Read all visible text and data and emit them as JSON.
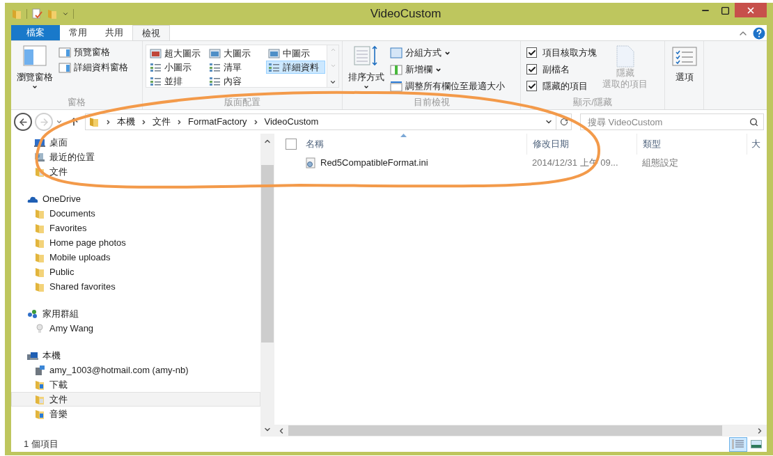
{
  "window": {
    "title": "VideoCustom"
  },
  "ribbon_tabs": [
    {
      "label": "檔案",
      "kind": "file",
      "selected": false
    },
    {
      "label": "常用",
      "kind": "tab",
      "selected": false
    },
    {
      "label": "共用",
      "kind": "tab",
      "selected": false
    },
    {
      "label": "檢視",
      "kind": "tab",
      "selected": true
    }
  ],
  "ribbon": {
    "panes": {
      "title": "窗格",
      "large": "瀏覽窗格",
      "small": [
        "預覽窗格",
        "詳細資料窗格"
      ]
    },
    "layout": {
      "title": "版面配置",
      "options": [
        {
          "label": "超大圖示",
          "selected": false
        },
        {
          "label": "大圖示",
          "selected": false
        },
        {
          "label": "中圖示",
          "selected": false
        },
        {
          "label": "小圖示",
          "selected": false
        },
        {
          "label": "清單",
          "selected": false
        },
        {
          "label": "詳細資料",
          "selected": true
        },
        {
          "label": "並排",
          "selected": false
        },
        {
          "label": "內容",
          "selected": false
        }
      ]
    },
    "current_view": {
      "title": "目前檢視",
      "large": "排序方式",
      "small": [
        {
          "label": "分組方式",
          "dropdown": true
        },
        {
          "label": "新增欄",
          "dropdown": true
        },
        {
          "label": "調整所有欄位至最適大小",
          "dropdown": false
        }
      ]
    },
    "show_hide": {
      "title": "顯示/隱藏",
      "checkboxes": [
        {
          "label": "項目核取方塊",
          "checked": true
        },
        {
          "label": "副檔名",
          "checked": true
        },
        {
          "label": "隱藏的項目",
          "checked": true
        }
      ],
      "hide_selected": {
        "lines": [
          "隱藏",
          "選取的項目"
        ],
        "disabled": true
      }
    },
    "options": {
      "label": "選項"
    }
  },
  "address": {
    "back_disabled": false,
    "forward_disabled": true,
    "path": [
      "本機",
      "文件",
      "FormatFactory",
      "VideoCustom"
    ],
    "search_placeholder": "搜尋 VideoCustom"
  },
  "nav_tree": [
    {
      "children": [
        {
          "label": "桌面",
          "kind": "desktop",
          "selected": false
        },
        {
          "label": "最近的位置",
          "kind": "recent",
          "selected": false
        },
        {
          "label": "文件",
          "kind": "docs",
          "selected": false
        }
      ]
    },
    {
      "label": "OneDrive",
      "kind": "cloud",
      "selected": false,
      "children": [
        {
          "label": "Documents",
          "kind": "folder",
          "selected": false
        },
        {
          "label": "Favorites",
          "kind": "folder",
          "selected": false
        },
        {
          "label": "Home page photos",
          "kind": "folder",
          "selected": false
        },
        {
          "label": "Mobile uploads",
          "kind": "folder",
          "selected": false
        },
        {
          "label": "Public",
          "kind": "folder",
          "selected": false
        },
        {
          "label": "Shared favorites",
          "kind": "folder",
          "selected": false
        }
      ]
    },
    {
      "label": "家用群組",
      "kind": "homegroup",
      "selected": false,
      "children": [
        {
          "label": "Amy Wang",
          "kind": "user",
          "selected": false
        }
      ]
    },
    {
      "label": "本機",
      "kind": "computer",
      "selected": false,
      "children": [
        {
          "label": "amy_1003@hotmail.com (amy-nb)",
          "kind": "drive",
          "selected": false
        },
        {
          "label": "下載",
          "kind": "download",
          "selected": false
        },
        {
          "label": "文件",
          "kind": "docs",
          "selected": true
        },
        {
          "label": "音樂",
          "kind": "music",
          "selected": false
        }
      ]
    }
  ],
  "file_list": {
    "select_all_checked": false,
    "columns": [
      "名稱",
      "修改日期",
      "類型",
      "大"
    ],
    "rows": [
      {
        "name": "Red5CompatibleFormat.ini",
        "modified": "2014/12/31 上午 09...",
        "type": "組態設定"
      }
    ]
  },
  "status_bar": {
    "count": "1 個項目",
    "views": [
      {
        "kind": "details",
        "selected": true
      },
      {
        "kind": "large",
        "selected": false
      }
    ]
  }
}
